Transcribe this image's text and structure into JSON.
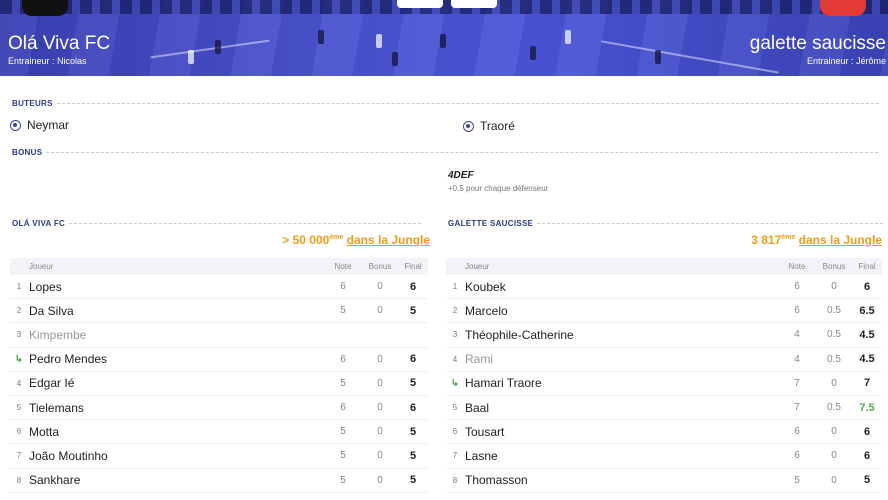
{
  "match": {
    "home": {
      "name": "Olá Viva FC",
      "coach": "Entraineur : Nicolas"
    },
    "away": {
      "name": "galette saucisse",
      "coach": "Entraineur : Jérôme"
    }
  },
  "sections": {
    "scorers_title": "BUTEURS",
    "bonus_title": "BONUS"
  },
  "scorers": {
    "home": [
      "Neymar"
    ],
    "away": [
      "Traoré"
    ]
  },
  "bonus": {
    "away": {
      "name": "4DEF",
      "desc": "+0.5 pour chaque défenseur"
    }
  },
  "home_team": {
    "title": "OLÁ VIVA FC",
    "rank_value": "> 50 000",
    "rank_sup": "ème",
    "rank_link": "dans la Jungle",
    "columns": {
      "player": "Joueur",
      "note": "Note",
      "bonus": "Bonus",
      "final": "Final"
    },
    "players": [
      {
        "num": "1",
        "name": "Lopes",
        "note": "6",
        "bonus": "0",
        "final": "6"
      },
      {
        "num": "2",
        "name": "Da Silva",
        "note": "5",
        "bonus": "0",
        "final": "5"
      },
      {
        "num": "3",
        "name": "Kimpembe",
        "note": "",
        "bonus": "",
        "final": "",
        "dim": true
      },
      {
        "num": "sub",
        "name": "Pedro Mendes",
        "note": "6",
        "bonus": "0",
        "final": "6"
      },
      {
        "num": "4",
        "name": "Edgar Ié",
        "note": "5",
        "bonus": "0",
        "final": "5"
      },
      {
        "num": "5",
        "name": "Tielemans",
        "note": "6",
        "bonus": "0",
        "final": "6"
      },
      {
        "num": "6",
        "name": "Motta",
        "note": "5",
        "bonus": "0",
        "final": "5"
      },
      {
        "num": "7",
        "name": "João Moutinho",
        "note": "5",
        "bonus": "0",
        "final": "5"
      },
      {
        "num": "8",
        "name": "Sankhare",
        "note": "5",
        "bonus": "0",
        "final": "5"
      }
    ]
  },
  "away_team": {
    "title": "GALETTE SAUCISSE",
    "rank_value": "3 817",
    "rank_sup": "ème",
    "rank_link": "dans la Jungle",
    "columns": {
      "player": "Joueur",
      "note": "Note",
      "bonus": "Bonus",
      "final": "Final"
    },
    "players": [
      {
        "num": "1",
        "name": "Koubek",
        "note": "6",
        "bonus": "0",
        "final": "6"
      },
      {
        "num": "2",
        "name": "Marcelo",
        "note": "6",
        "bonus": "0.5",
        "final": "6.5"
      },
      {
        "num": "3",
        "name": "Théophile-Catherine",
        "note": "4",
        "bonus": "0.5",
        "final": "4.5"
      },
      {
        "num": "4",
        "name": "Rami",
        "note": "4",
        "bonus": "0.5",
        "final": "4.5",
        "dim": true
      },
      {
        "num": "sub",
        "name": "Hamari Traore",
        "note": "7",
        "bonus": "0",
        "final": "7"
      },
      {
        "num": "5",
        "name": "Baal",
        "note": "7",
        "bonus": "0.5",
        "final": "7.5",
        "green": true
      },
      {
        "num": "6",
        "name": "Tousart",
        "note": "6",
        "bonus": "0",
        "final": "6"
      },
      {
        "num": "7",
        "name": "Lasne",
        "note": "6",
        "bonus": "0",
        "final": "6"
      },
      {
        "num": "8",
        "name": "Thomasson",
        "note": "5",
        "bonus": "0",
        "final": "5"
      }
    ]
  },
  "colors": {
    "banner": "#4a52cf",
    "accent": "#f39c12",
    "section": "#2b3a8c",
    "green": "#4caf50"
  }
}
